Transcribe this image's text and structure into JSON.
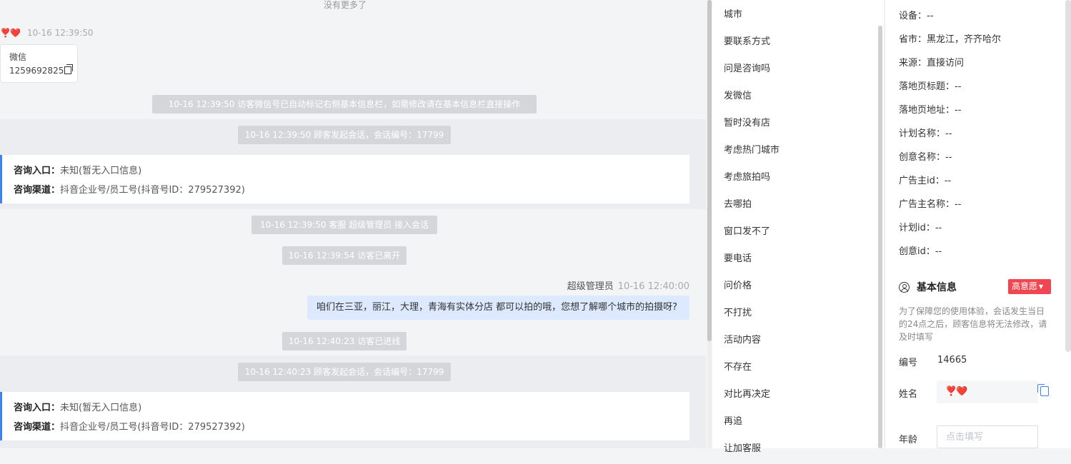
{
  "chat": {
    "no_more": "没有更多了",
    "visitor_name": "❣️❤️",
    "visitor_time": "10-16 12:39:50",
    "wechat_card": {
      "label": "微信",
      "value": "1259692825"
    },
    "sys1": "10-16 12:39:50 访客微信号已自动标记右侧基本信息栏，如需修改请在基本信息栏直接操作",
    "sys2": "10-16 12:39:50 顾客发起会话，会话编号：17799",
    "info1": {
      "entry_label": "咨询入口：",
      "entry_value": "未知(暂无入口信息)",
      "channel_label": "咨询渠道：",
      "channel_value": "抖音企业号/员工号(抖音号ID：279527392)"
    },
    "sys3": "10-16 12:39:50 客服 超级管理员 接入会话",
    "sys4": "10-16 12:39:54 访客已离开",
    "agent_name": "超级管理员",
    "agent_time": "10-16 12:40:00",
    "agent_message": "咱们在三亚，丽江，大理，青海有实体分店 都可以拍的哦，您想了解哪个城市的拍摄呀?",
    "sys5": "10-16 12:40:23 访客已进线",
    "sys6": "10-16 12:40:23 顾客发起会话，会话编号：17799",
    "info2": {
      "entry_label": "咨询入口：",
      "entry_value": "未知(暂无入口信息)",
      "channel_label": "咨询渠道：",
      "channel_value": "抖音企业号/员工号(抖音号ID：279527392)"
    }
  },
  "quick_replies": [
    "城市",
    "要联系方式",
    "问是咨询吗",
    "发微信",
    "暂时没有店",
    "考虑热门城市",
    "考虑旅拍吗",
    "去哪拍",
    "窗口发不了",
    "要电话",
    "问价格",
    "不打扰",
    "活动内容",
    "不存在",
    "对比再决定",
    "再追",
    "让加客服"
  ],
  "side": {
    "device": "设备：--",
    "province": "省市：黑龙江，齐齐哈尔",
    "source": "来源：直接访问",
    "landing_title": "落地页标题：--",
    "landing_url": "落地页地址：--",
    "plan_name": "计划名称：--",
    "creative_name": "创意名称：--",
    "advertiser_id": "广告主id：--",
    "advertiser_name": "广告主名称：--",
    "plan_id": "计划id：--",
    "creative_id": "创意id：--",
    "basic_title": "基本信息",
    "intent_badge": "高意愿",
    "notice": "为了保障您的使用体验，会话发生当日的24点之后，顾客信息将无法修改，请及时填写",
    "number_label": "编号",
    "number_value": "14665",
    "name_label": "姓名",
    "name_value": "❣️❤️",
    "age_label": "年龄",
    "age_placeholder": "点击填写"
  },
  "colors": {
    "accent": "#3b82f6",
    "badge": "#ef4651",
    "agent_bubble": "#dce9ff"
  }
}
